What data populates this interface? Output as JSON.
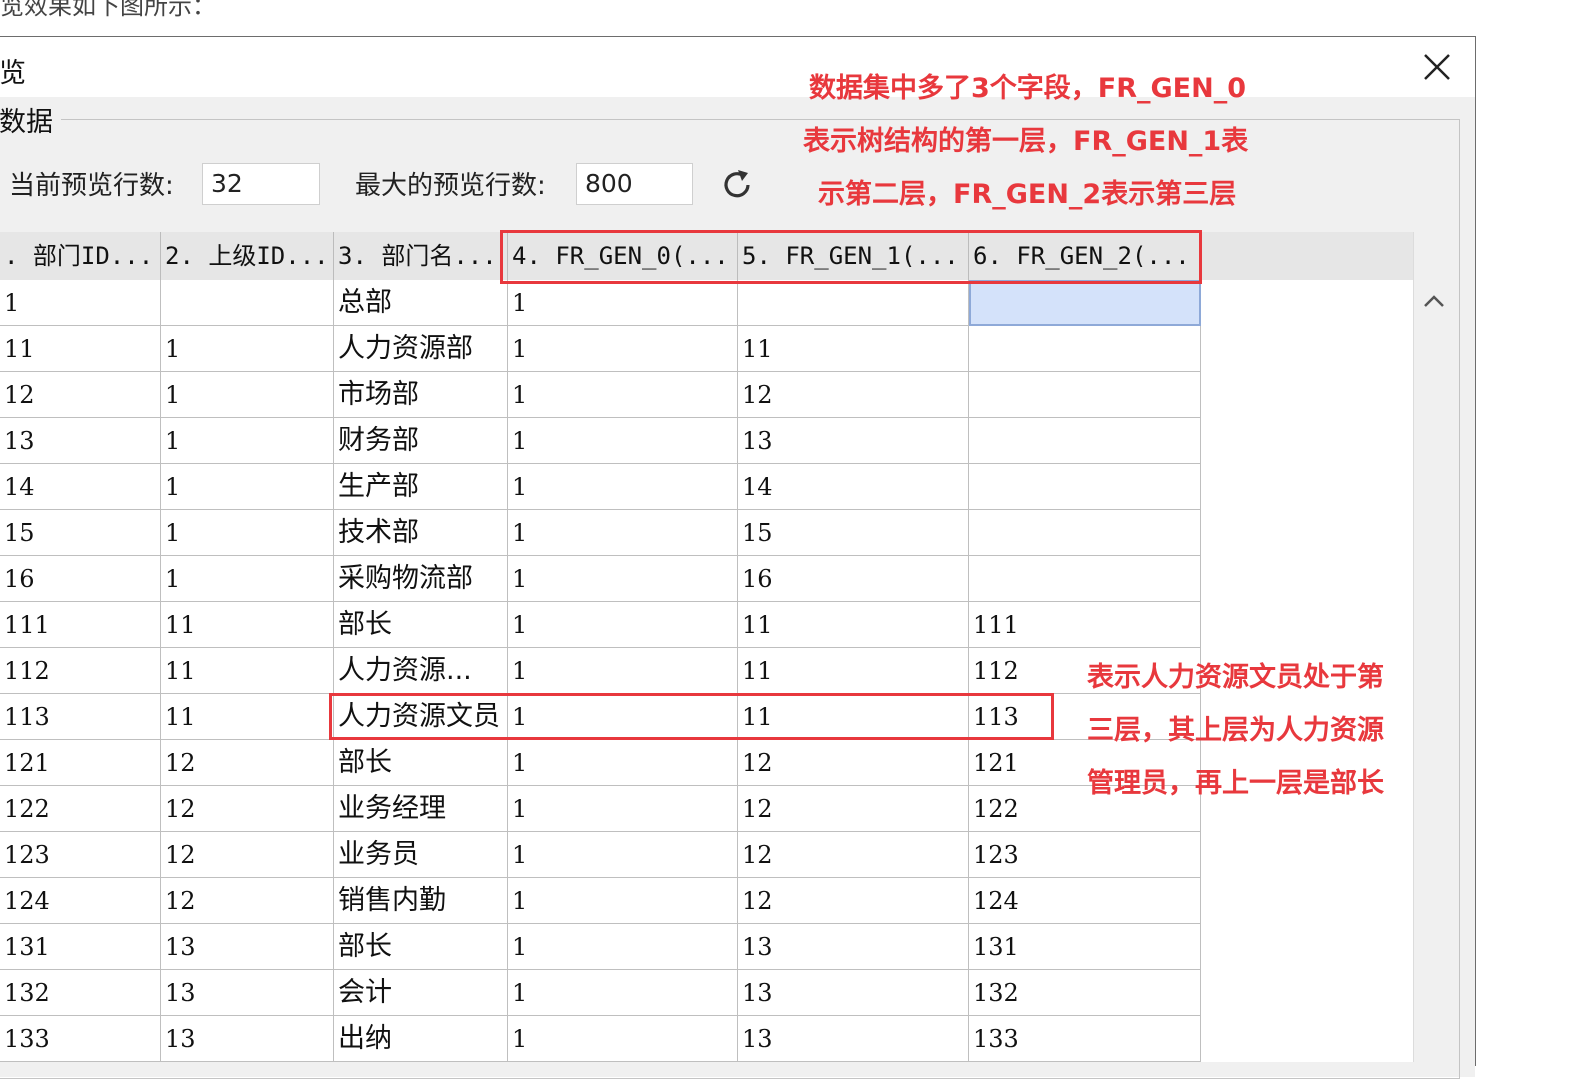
{
  "top_caption": "览效果如下图所示：",
  "dialog": {
    "title": "览",
    "section_title": "数据",
    "current_rows_label": "当前预览行数:",
    "current_rows_value": "32",
    "max_rows_label": "最大的预览行数:",
    "max_rows_value": "800",
    "refresh_icon": "refresh-icon",
    "close_icon": "close-icon"
  },
  "table": {
    "headers": [
      ". 部门ID...",
      "2. 上级ID...",
      "3. 部门名...",
      "4. FR_GEN_0(...",
      "5. FR_GEN_1(...",
      "6. FR_GEN_2(..."
    ],
    "rows": [
      [
        "1",
        "",
        "总部",
        "1",
        "",
        ""
      ],
      [
        "11",
        "1",
        "人力资源部",
        "1",
        "11",
        ""
      ],
      [
        "12",
        "1",
        "市场部",
        "1",
        "12",
        ""
      ],
      [
        "13",
        "1",
        "财务部",
        "1",
        "13",
        ""
      ],
      [
        "14",
        "1",
        "生产部",
        "1",
        "14",
        ""
      ],
      [
        "15",
        "1",
        "技术部",
        "1",
        "15",
        ""
      ],
      [
        "16",
        "1",
        "采购物流部",
        "1",
        "16",
        ""
      ],
      [
        "111",
        "11",
        "部长",
        "1",
        "11",
        "111"
      ],
      [
        "112",
        "11",
        "人力资源...",
        "1",
        "11",
        "112"
      ],
      [
        "113",
        "11",
        "人力资源文员",
        "1",
        "11",
        "113"
      ],
      [
        "121",
        "12",
        "部长",
        "1",
        "12",
        "121"
      ],
      [
        "122",
        "12",
        "业务经理",
        "1",
        "12",
        "122"
      ],
      [
        "123",
        "12",
        "业务员",
        "1",
        "12",
        "123"
      ],
      [
        "124",
        "12",
        "销售内勤",
        "1",
        "12",
        "124"
      ],
      [
        "131",
        "13",
        "部长",
        "1",
        "13",
        "131"
      ],
      [
        "132",
        "13",
        "会计",
        "1",
        "13",
        "132"
      ],
      [
        "133",
        "13",
        "出纳",
        "1",
        "13",
        "133"
      ]
    ]
  },
  "annotations": {
    "top": [
      "数据集中多了3个字段，FR_GEN_0",
      "表示树结构的第一层，FR_GEN_1表",
      "示第二层，FR_GEN_2表示第三层"
    ],
    "right": [
      "表示人力资源文员处于第",
      "三层，其上层为人力资源",
      "管理员，再上一层是部长"
    ],
    "color": "#e8383d"
  }
}
